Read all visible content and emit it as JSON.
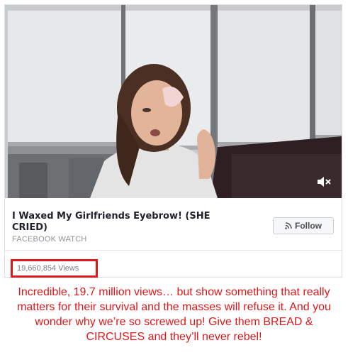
{
  "post": {
    "video_title": "I Waxed My Girlfriends Eyebrow! (SHE CRIED)",
    "source": "FACEBOOK WATCH",
    "follow_label": "Follow",
    "views": "19,660,854 Views",
    "mute_icon": "volume-mute-icon",
    "follow_icon": "rss-icon"
  },
  "caption": "Incredible, 19.7 million views… but show something that really matters for their survival and the masses will refuse it. And you wonder why we’re so screwed up! Give them BREAD & CIRCUSES and they’ll never rebel!",
  "colors": {
    "highlight": "#e0181b",
    "caption": "#e0181b",
    "title": "#1d2129",
    "muted_text": "#90949c"
  }
}
